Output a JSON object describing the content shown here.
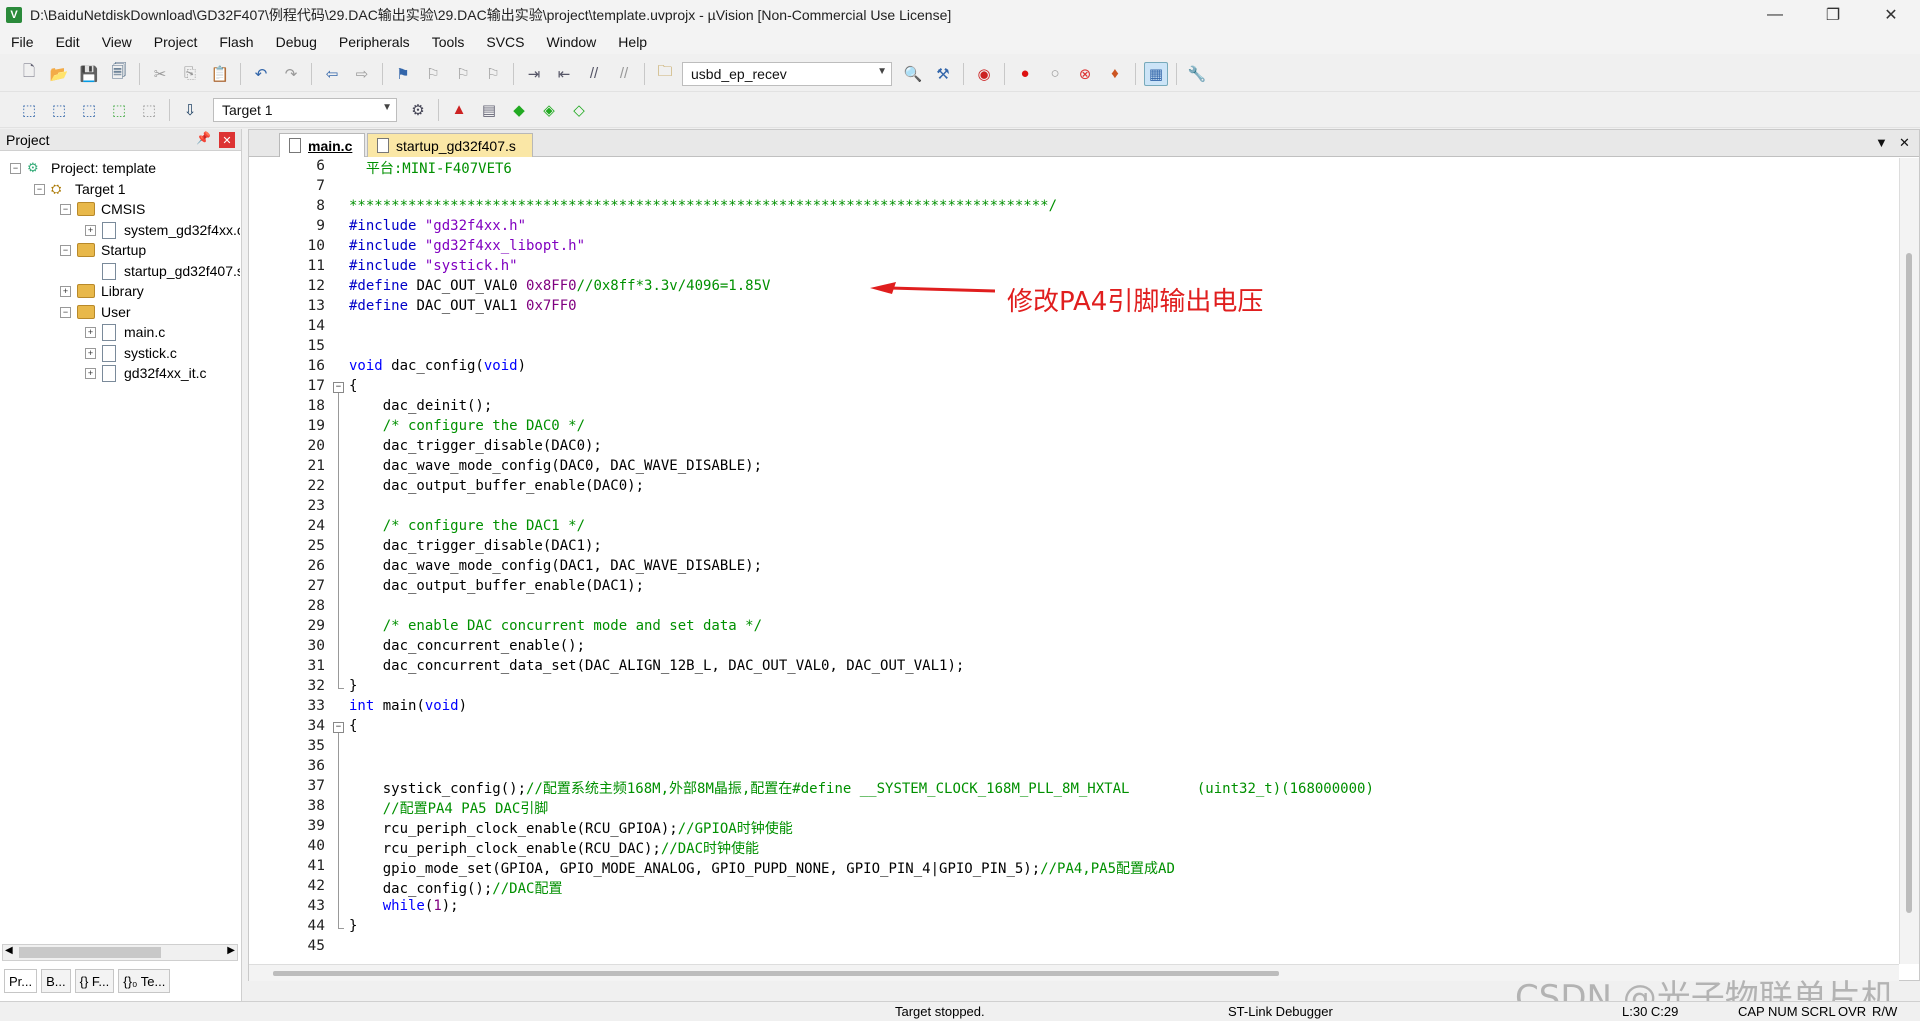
{
  "window": {
    "title": "D:\\BaiduNetdiskDownload\\GD32F407\\例程代码\\29.DAC输出实验\\29.DAC输出实验\\project\\template.uvprojx - µVision  [Non-Commercial Use License]",
    "minimize": "—",
    "maximize": "❐",
    "close": "✕"
  },
  "menu": [
    "File",
    "Edit",
    "View",
    "Project",
    "Flash",
    "Debug",
    "Peripherals",
    "Tools",
    "SVCS",
    "Window",
    "Help"
  ],
  "toolbar": {
    "find_combo_value": "usbd_ep_recev",
    "target_combo_value": "Target 1"
  },
  "project_panel": {
    "title": "Project",
    "pin": "ꟸ",
    "close": "✕",
    "tree": {
      "project": "Project: template",
      "target": "Target 1",
      "groups": [
        {
          "name": "CMSIS",
          "files": [
            "system_gd32f4xx.c"
          ]
        },
        {
          "name": "Startup",
          "files": [
            "startup_gd32f407.s"
          ]
        },
        {
          "name": "Library",
          "files": []
        },
        {
          "name": "User",
          "files": [
            "main.c",
            "systick.c",
            "gd32f4xx_it.c"
          ]
        }
      ]
    },
    "tabs": [
      "Pr...",
      "B...",
      "{} F...",
      "{}₀ Te..."
    ]
  },
  "editor": {
    "tabs": [
      "main.c",
      "startup_gd32f407.s"
    ],
    "active_tab": "main.c",
    "lines": [
      {
        "n": "6",
        "parts": [
          {
            "t": "  平台:MINI-F407VET6",
            "c": "cmt"
          }
        ]
      },
      {
        "n": "7",
        "parts": []
      },
      {
        "n": "8",
        "parts": [
          {
            "t": "***********************************************************************************/",
            "c": "cmt"
          }
        ]
      },
      {
        "n": "9",
        "parts": [
          {
            "t": "#include ",
            "c": "pp"
          },
          {
            "t": "\"gd32f4xx.h\"",
            "c": "str"
          }
        ]
      },
      {
        "n": "10",
        "parts": [
          {
            "t": "#include ",
            "c": "pp"
          },
          {
            "t": "\"gd32f4xx_libopt.h\"",
            "c": "str"
          }
        ]
      },
      {
        "n": "11",
        "parts": [
          {
            "t": "#include ",
            "c": "pp"
          },
          {
            "t": "\"systick.h\"",
            "c": "str"
          }
        ]
      },
      {
        "n": "12",
        "parts": [
          {
            "t": "#define ",
            "c": "pp"
          },
          {
            "t": "DAC_OUT_VAL0 ",
            "c": ""
          },
          {
            "t": "0x8FF0",
            "c": "num"
          },
          {
            "t": "//0x8ff*3.3v/4096=1.85V",
            "c": "cmt"
          }
        ]
      },
      {
        "n": "13",
        "parts": [
          {
            "t": "#define ",
            "c": "pp"
          },
          {
            "t": "DAC_OUT_VAL1 ",
            "c": ""
          },
          {
            "t": "0x7FF0",
            "c": "num"
          }
        ]
      },
      {
        "n": "14",
        "parts": []
      },
      {
        "n": "15",
        "parts": []
      },
      {
        "n": "16",
        "parts": [
          {
            "t": "void",
            "c": "kw"
          },
          {
            "t": " dac_config(",
            "c": ""
          },
          {
            "t": "void",
            "c": "kw"
          },
          {
            "t": ")",
            "c": ""
          }
        ]
      },
      {
        "n": "17",
        "fold": "open",
        "parts": [
          {
            "t": "{",
            "c": ""
          }
        ]
      },
      {
        "n": "18",
        "fold": "line",
        "parts": [
          {
            "t": "    dac_deinit();",
            "c": ""
          }
        ]
      },
      {
        "n": "19",
        "fold": "line",
        "parts": [
          {
            "t": "    /* configure the DAC0 */",
            "c": "cmt"
          }
        ]
      },
      {
        "n": "20",
        "fold": "line",
        "parts": [
          {
            "t": "    dac_trigger_disable(DAC0);",
            "c": ""
          }
        ]
      },
      {
        "n": "21",
        "fold": "line",
        "parts": [
          {
            "t": "    dac_wave_mode_config(DAC0, DAC_WAVE_DISABLE);",
            "c": ""
          }
        ]
      },
      {
        "n": "22",
        "fold": "line",
        "parts": [
          {
            "t": "    dac_output_buffer_enable(DAC0);",
            "c": ""
          }
        ]
      },
      {
        "n": "23",
        "fold": "line",
        "parts": []
      },
      {
        "n": "24",
        "fold": "line",
        "parts": [
          {
            "t": "    /* configure the DAC1 */",
            "c": "cmt"
          }
        ]
      },
      {
        "n": "25",
        "fold": "line",
        "parts": [
          {
            "t": "    dac_trigger_disable(DAC1);",
            "c": ""
          }
        ]
      },
      {
        "n": "26",
        "fold": "line",
        "parts": [
          {
            "t": "    dac_wave_mode_config(DAC1, DAC_WAVE_DISABLE);",
            "c": ""
          }
        ]
      },
      {
        "n": "27",
        "fold": "line",
        "parts": [
          {
            "t": "    dac_output_buffer_enable(DAC1);",
            "c": ""
          }
        ]
      },
      {
        "n": "28",
        "fold": "line",
        "parts": []
      },
      {
        "n": "29",
        "fold": "line",
        "parts": [
          {
            "t": "    /* enable DAC concurrent mode and set data */",
            "c": "cmt"
          }
        ]
      },
      {
        "n": "30",
        "fold": "line",
        "parts": [
          {
            "t": "    dac_concurrent_enable();",
            "c": ""
          }
        ]
      },
      {
        "n": "31",
        "fold": "line",
        "parts": [
          {
            "t": "    dac_concurrent_data_set(DAC_ALIGN_12B_L, DAC_OUT_VAL0, DAC_OUT_VAL1);",
            "c": ""
          }
        ]
      },
      {
        "n": "32",
        "fold": "end",
        "parts": [
          {
            "t": "}",
            "c": ""
          }
        ]
      },
      {
        "n": "33",
        "parts": [
          {
            "t": "int",
            "c": "kw"
          },
          {
            "t": " main(",
            "c": ""
          },
          {
            "t": "void",
            "c": "kw"
          },
          {
            "t": ")",
            "c": ""
          }
        ]
      },
      {
        "n": "34",
        "fold": "open",
        "parts": [
          {
            "t": "{",
            "c": ""
          }
        ]
      },
      {
        "n": "35",
        "fold": "line",
        "parts": []
      },
      {
        "n": "36",
        "fold": "line",
        "parts": []
      },
      {
        "n": "37",
        "fold": "line",
        "parts": [
          {
            "t": "    systick_config();",
            "c": ""
          },
          {
            "t": "//配置系统主频168M,外部8M晶振,配置在#define __SYSTEM_CLOCK_168M_PLL_8M_HXTAL        (uint32_t)(168000000)",
            "c": "cmt"
          }
        ]
      },
      {
        "n": "38",
        "fold": "line",
        "parts": [
          {
            "t": "    //配置PA4 PA5 DAC引脚",
            "c": "cmt"
          }
        ]
      },
      {
        "n": "39",
        "fold": "line",
        "parts": [
          {
            "t": "    rcu_periph_clock_enable(RCU_GPIOA);",
            "c": ""
          },
          {
            "t": "//GPIOA时钟使能",
            "c": "cmt"
          }
        ]
      },
      {
        "n": "40",
        "fold": "line",
        "parts": [
          {
            "t": "    rcu_periph_clock_enable(RCU_DAC);",
            "c": ""
          },
          {
            "t": "//DAC时钟使能",
            "c": "cmt"
          }
        ]
      },
      {
        "n": "41",
        "fold": "line",
        "parts": [
          {
            "t": "    gpio_mode_set(GPIOA, GPIO_MODE_ANALOG, GPIO_PUPD_NONE, GPIO_PIN_4|GPIO_PIN_5);",
            "c": ""
          },
          {
            "t": "//PA4,PA5配置成AD",
            "c": "cmt"
          }
        ]
      },
      {
        "n": "42",
        "fold": "line",
        "parts": [
          {
            "t": "    dac_config();",
            "c": ""
          },
          {
            "t": "//DAC配置",
            "c": "cmt"
          }
        ]
      },
      {
        "n": "43",
        "fold": "line",
        "parts": [
          {
            "t": "    ",
            "c": ""
          },
          {
            "t": "while",
            "c": "kw"
          },
          {
            "t": "(",
            "c": ""
          },
          {
            "t": "1",
            "c": "num"
          },
          {
            "t": ");",
            "c": ""
          }
        ]
      },
      {
        "n": "44",
        "fold": "end",
        "parts": [
          {
            "t": "}",
            "c": ""
          }
        ]
      },
      {
        "n": "45",
        "parts": []
      }
    ],
    "annotation": "修改PA4引脚输出电压"
  },
  "statusbar": {
    "message": "Target stopped.",
    "debugger": "ST-Link Debugger",
    "position": "L:30 C:29",
    "indicators": [
      "CAP",
      "NUM",
      "SCRL",
      "OVR",
      "R/W"
    ]
  },
  "watermark": "CSDN @光子物联单片机",
  "colors": {
    "keyword": "#0000ff",
    "comment": "#009000",
    "string": "#8000c0",
    "annotation": "#e01e1e"
  }
}
